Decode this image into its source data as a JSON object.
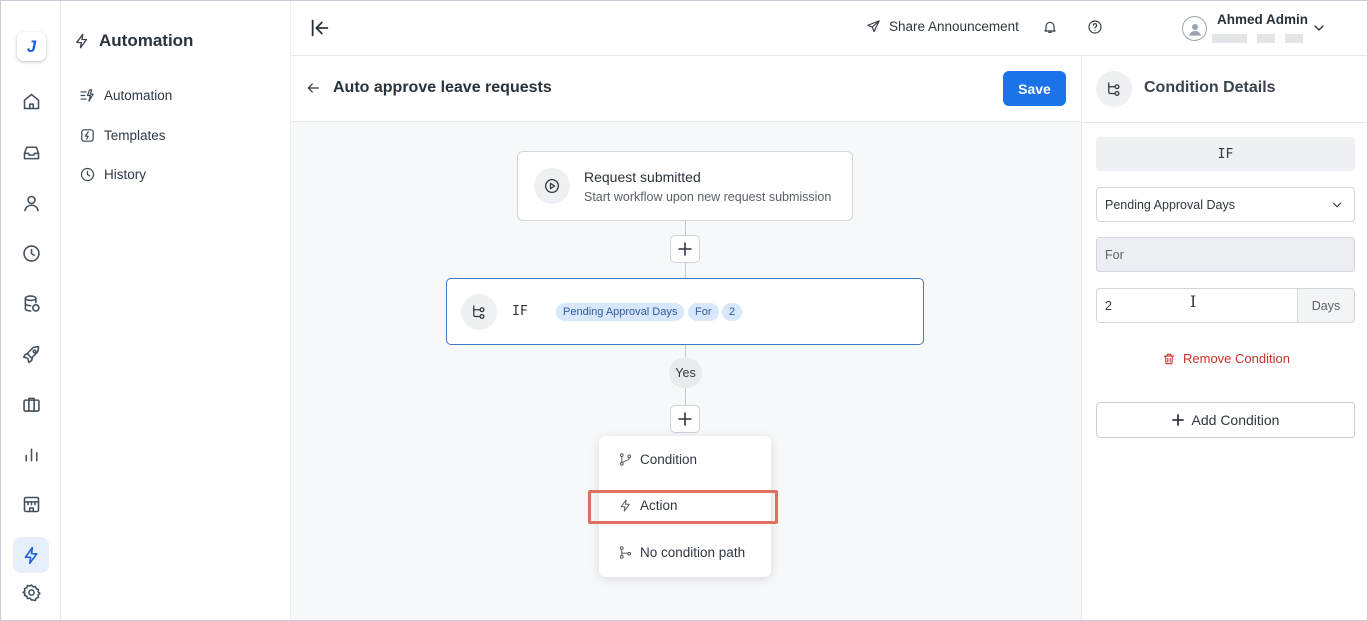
{
  "rail": {
    "logo_letter": "J",
    "items": [
      "home-icon",
      "inbox-icon",
      "user-icon",
      "clock-icon",
      "database-icon",
      "rocket-icon",
      "briefcase-icon",
      "bar-chart-icon",
      "store-icon",
      "lightning-icon",
      "settings-icon"
    ],
    "active": "lightning-icon"
  },
  "subnav": {
    "title": "Automation",
    "items": [
      {
        "label": "Automation",
        "icon": "automation-icon"
      },
      {
        "label": "Templates",
        "icon": "templates-icon"
      },
      {
        "label": "History",
        "icon": "history-icon"
      }
    ]
  },
  "topbar": {
    "share_label": "Share Announcement",
    "user_name": "Ahmed Admin"
  },
  "editor": {
    "title": "Auto approve leave requests",
    "save_label": "Save",
    "accent": "#1a73e8"
  },
  "canvas": {
    "trigger": {
      "title": "Request submitted",
      "subtitle": "Start workflow upon new request submission"
    },
    "condition_node": {
      "label": "IF",
      "chips": [
        "Pending Approval Days",
        "For",
        "2"
      ]
    },
    "branch_label": "Yes",
    "menu": {
      "items": [
        {
          "label": "Condition",
          "icon": "branch-icon"
        },
        {
          "label": "Action",
          "icon": "lightning-icon"
        },
        {
          "label": "No condition path",
          "icon": "path-icon"
        }
      ],
      "highlighted": "Action"
    }
  },
  "panel": {
    "title": "Condition Details",
    "if_label": "IF",
    "field_selected": "Pending Approval Days",
    "operator": "For",
    "value": "2",
    "unit": "Days",
    "remove_label": "Remove Condition",
    "add_label": "Add Condition",
    "danger_color": "#c7322b"
  }
}
